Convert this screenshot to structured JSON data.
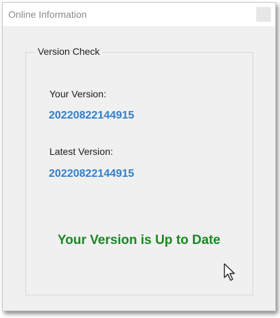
{
  "window": {
    "title": "Online Information"
  },
  "group": {
    "label": "Version Check"
  },
  "your_version": {
    "label": "Your Version:",
    "value": "20220822144915"
  },
  "latest_version": {
    "label": "Latest Version:",
    "value": "20220822144915"
  },
  "status": {
    "text": "Your Version is Up to Date",
    "color": "#168a1f"
  },
  "colors": {
    "version_value": "#2f7fd0",
    "dialog_background": "#f0f0f0"
  },
  "icons": {
    "cursor": "mouse-pointer-icon",
    "close": "close-icon"
  }
}
